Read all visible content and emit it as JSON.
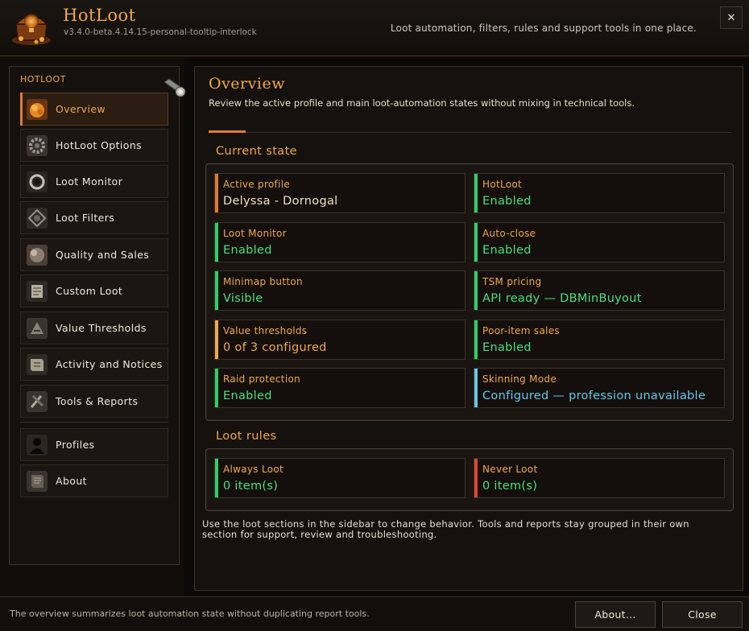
{
  "app": {
    "title": "HotLoot",
    "version": "v3.4.0-beta.4.14.15-personal-tooltip-interlock",
    "tagline": "Loot automation, filters, rules and support tools in one place.",
    "close_glyph": "✕"
  },
  "sidebar": {
    "heading": "HOTLOOT",
    "items": [
      {
        "label": "Overview",
        "icon": "coin-pile-icon",
        "active": true
      },
      {
        "label": "HotLoot Options",
        "icon": "gear-icon"
      },
      {
        "label": "Loot Monitor",
        "icon": "ring-icon"
      },
      {
        "label": "Loot Filters",
        "icon": "filter-icon"
      },
      {
        "label": "Quality and Sales",
        "icon": "dust-icon"
      },
      {
        "label": "Custom Loot",
        "icon": "scroll-icon"
      },
      {
        "label": "Value Thresholds",
        "icon": "rune-icon"
      },
      {
        "label": "Activity and Notices",
        "icon": "notice-scroll-icon"
      },
      {
        "label": "Tools & Reports",
        "icon": "tools-icon"
      },
      {
        "label": "Profiles",
        "icon": "profile-silhouette-icon"
      },
      {
        "label": "About",
        "icon": "book-icon"
      }
    ]
  },
  "main": {
    "title": "Overview",
    "subtitle": "Review the active profile and main loot-automation states without mixing in technical tools.",
    "current_state": {
      "title": "Current state",
      "cards": [
        {
          "label": "Active profile",
          "value": "Delyssa - Dornogal",
          "status": "neutral"
        },
        {
          "label": "HotLoot",
          "value": "Enabled",
          "status": "ok"
        },
        {
          "label": "Loot Monitor",
          "value": "Enabled",
          "status": "ok"
        },
        {
          "label": "Auto-close",
          "value": "Enabled",
          "status": "ok"
        },
        {
          "label": "Minimap button",
          "value": "Visible",
          "status": "ok"
        },
        {
          "label": "TSM pricing",
          "value": "API ready — DBMinBuyout",
          "status": "ok"
        },
        {
          "label": "Value thresholds",
          "value": "0 of 3 configured",
          "status": "warn"
        },
        {
          "label": "Poor-item sales",
          "value": "Enabled",
          "status": "ok"
        },
        {
          "label": "Raid protection",
          "value": "Enabled",
          "status": "ok"
        },
        {
          "label": "Skinning Mode",
          "value": "Configured — profession unavailable",
          "status": "info"
        }
      ]
    },
    "loot_rules": {
      "title": "Loot rules",
      "cards": [
        {
          "label": "Always Loot",
          "value": "0 item(s)",
          "status": "ok"
        },
        {
          "label": "Never Loot",
          "value": "0 item(s)",
          "status": "bad"
        }
      ]
    },
    "footnote": "Use the loot sections in the sidebar to change behavior. Tools and reports stay grouped in their own section for support, review and troubleshooting."
  },
  "status_bar": {
    "text": "The overview summarizes loot automation state without duplicating report tools.",
    "about_label": "About...",
    "close_label": "Close"
  },
  "colors": {
    "accent": "#f0a94a",
    "active_bar": "#e07b2f",
    "ok": "#2ecf63",
    "ok_text": "#49e07c",
    "warn": "#f0a94a",
    "info": "#64c8e8",
    "bad": "#e0452f"
  }
}
